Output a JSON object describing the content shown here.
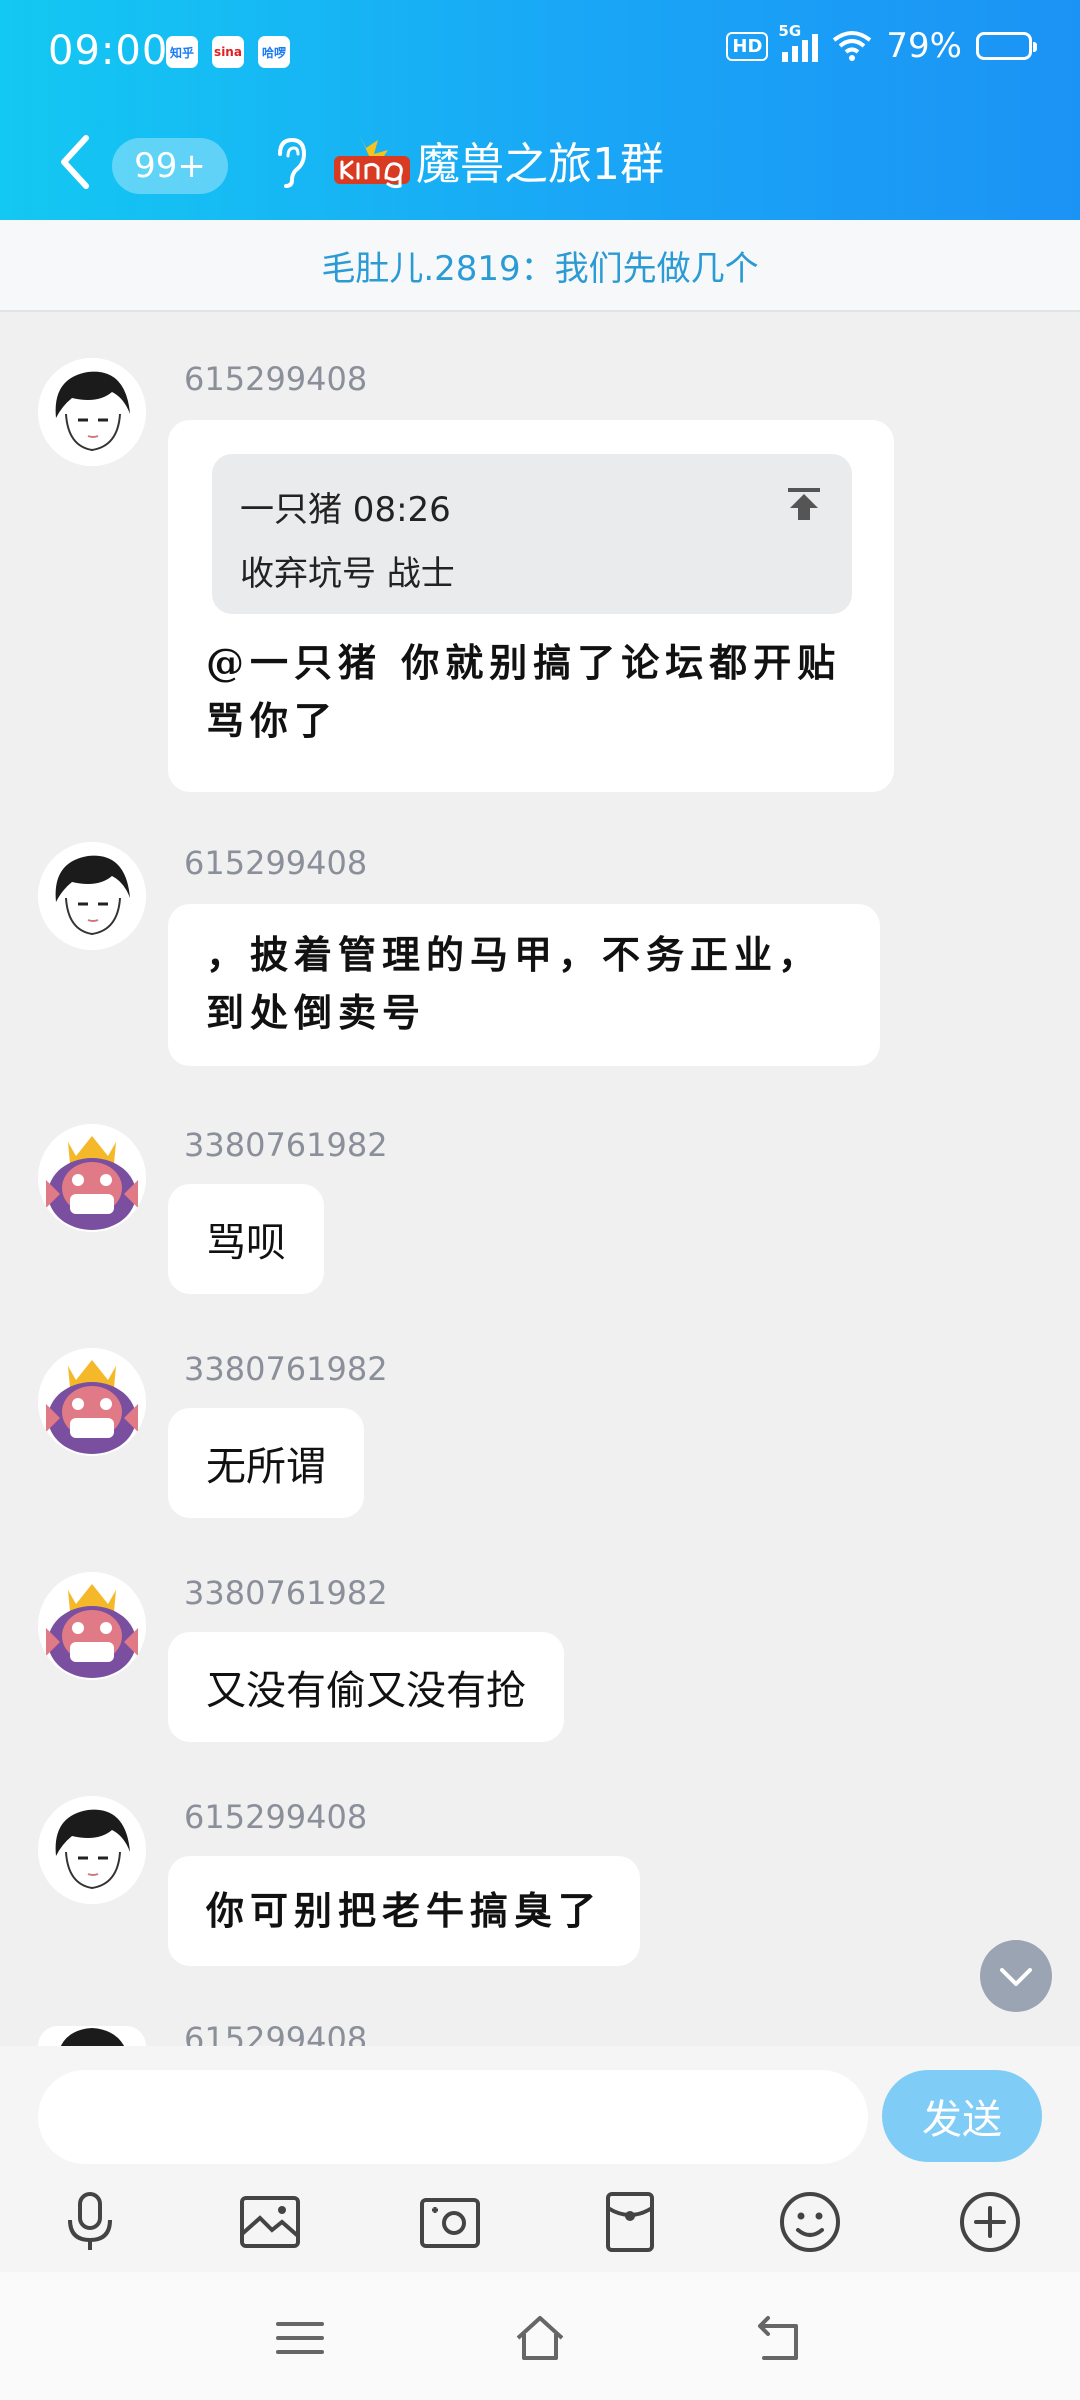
{
  "status_bar": {
    "time": "09:00",
    "app_icons": [
      "知乎",
      "sina",
      "哈啰"
    ],
    "hd": "HD",
    "network": "5G",
    "battery": "79%"
  },
  "header": {
    "unread_badge": "99+",
    "group_title": "魔兽之旅1群"
  },
  "pinned": {
    "text": "毛肚儿.2819：我们先做几个"
  },
  "messages": [
    {
      "sender": "615299408",
      "quote_header": "一只猪 08:26",
      "quote_body": "收弃坑号 战士",
      "text_line1": "@一只猪 你就别搞了论坛都开贴",
      "text_line2": "骂你了"
    },
    {
      "sender": "615299408",
      "text_line1": "，披着管理的马甲，不务正业，",
      "text_line2": "到处倒卖号"
    },
    {
      "sender": "3380761982",
      "text": "骂呗"
    },
    {
      "sender": "3380761982",
      "text": "无所谓"
    },
    {
      "sender": "3380761982",
      "text": "又没有偷又没有抢"
    },
    {
      "sender": "615299408",
      "text": "你可别把老牛搞臭了"
    },
    {
      "sender": "615299408"
    }
  ],
  "composer": {
    "input_value": "",
    "send_label": "发送"
  },
  "colors": {
    "header_start": "#13c8f2",
    "header_end": "#1b93f5",
    "pinned_text": "#2a9bd4",
    "send_button": "#7fcdf7"
  },
  "icons": [
    "back-arrow-icon",
    "ear-icon",
    "pin-top-icon",
    "chevron-down-icon",
    "mic-icon",
    "image-icon",
    "camera-icon",
    "red-packet-icon",
    "emoji-icon",
    "plus-icon",
    "menu-icon",
    "home-icon",
    "back-icon"
  ]
}
